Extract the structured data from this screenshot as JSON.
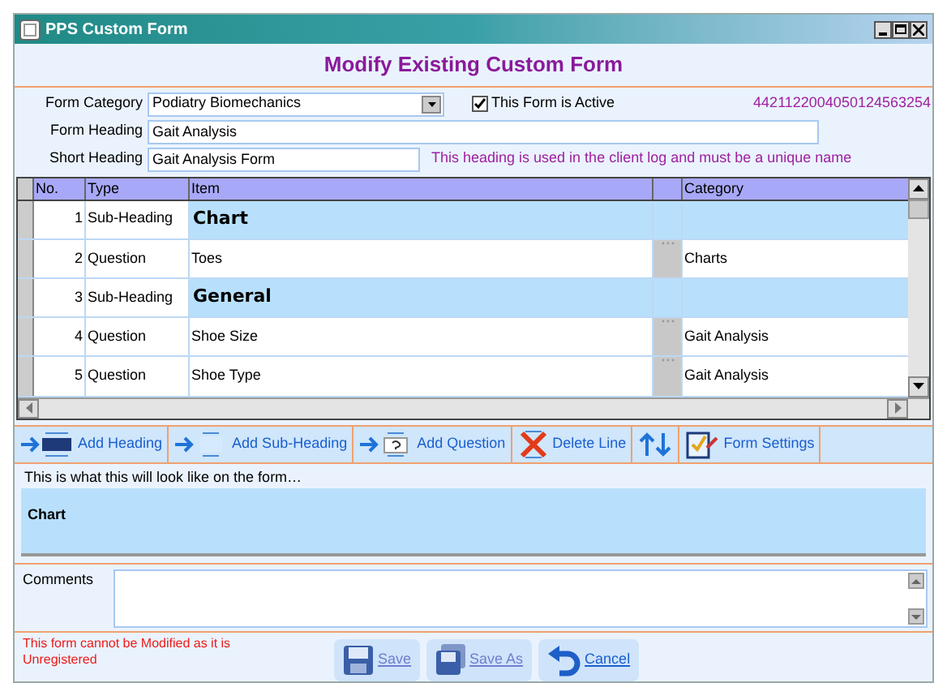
{
  "window": {
    "title": "PPS Custom Form"
  },
  "heading": "Modify Existing Custom Form",
  "form": {
    "category_label": "Form Category",
    "category": "Podiatry Biomechanics",
    "active_label": "This Form is Active",
    "active": true,
    "code": "4421122004050124563254",
    "heading_label": "Form Heading",
    "heading_value": "Gait Analysis",
    "short_label": "Short Heading",
    "short_value": "Gait Analysis Form",
    "short_note": "This heading is used in the client log and must be a unique name"
  },
  "table": {
    "columns": [
      "No.",
      "Type",
      "Item",
      "Category"
    ],
    "rows": [
      {
        "no": "1",
        "type": "Sub-Heading",
        "item": "Chart",
        "category": "",
        "kind": "subheading"
      },
      {
        "no": "2",
        "type": "Question",
        "item": "Toes",
        "category": "Charts",
        "kind": "question"
      },
      {
        "no": "3",
        "type": "Sub-Heading",
        "item": "General",
        "category": "",
        "kind": "subheading"
      },
      {
        "no": "4",
        "type": "Question",
        "item": "Shoe Size",
        "category": "Gait Analysis",
        "kind": "question"
      },
      {
        "no": "5",
        "type": "Question",
        "item": "Shoe Type",
        "category": "Gait Analysis",
        "kind": "question"
      }
    ]
  },
  "toolbar": [
    {
      "label": "Add Heading",
      "kind": "heading"
    },
    {
      "label": "Add Sub-Heading",
      "kind": "subheading"
    },
    {
      "label": "Add Question",
      "kind": "question"
    },
    {
      "label": "Delete Line",
      "kind": "delete"
    },
    {
      "kind": "move"
    },
    {
      "label": "Form Settings",
      "kind": "settings"
    }
  ],
  "preview": {
    "caption": "This is what this will look like on the form…",
    "text": "Chart"
  },
  "comments": {
    "label": "Comments"
  },
  "warning": "This form cannot be Modified as it is Unregistered",
  "buttons": [
    {
      "label": "Save",
      "kind": "save",
      "disabled": true
    },
    {
      "label": "Save As",
      "kind": "saveas",
      "disabled": true
    },
    {
      "label": "Cancel",
      "kind": "cancel",
      "disabled": false
    }
  ]
}
